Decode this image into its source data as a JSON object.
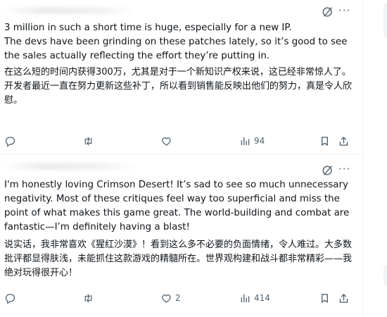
{
  "posts": [
    {
      "header": {
        "grok_icon": "grok-icon",
        "more_icon": "more-icon",
        "more_glyph": "···"
      },
      "text_en": "3 million in such a short time is huge, especially for a new IP.\nThe devs have been grinding on these patches lately, so it’s good to see the sales actually reflecting the effort they’re putting in.",
      "text_zh": "在这么短的时间内获得300万，尤其是对于一个新知识产权来说，这已经非常惊人了。\n开发者最近一直在努力更新这些补丁，所以看到销售能反映出他们的努力，真是令人欣慰。",
      "actions": {
        "replies": "",
        "reposts": "",
        "likes": "",
        "views": "94"
      }
    },
    {
      "header": {
        "grok_icon": "grok-icon",
        "more_icon": "more-icon",
        "more_glyph": "···"
      },
      "text_en": "I'm honestly loving Crimson Desert! It’s sad to see so much unnecessary negativity. Most of these critiques feel way too superficial and miss the point of what makes this game great. The world-building and combat are fantastic—I’m definitely having a blast!",
      "text_zh": "说实话，我非常喜欢《猩红沙漠》！看到这么多不必要的负面情绪，令人难过。大多数批评都显得肤浅，未能抓住这款游戏的精髓所在。世界观构建和战斗都非常精彩——我绝对玩得很开心！",
      "actions": {
        "replies": "",
        "reposts": "",
        "likes": "2",
        "views": "414"
      }
    }
  ],
  "colors": {
    "icon": "#536471",
    "text": "#0f1419",
    "divider": "#eff3f4"
  }
}
